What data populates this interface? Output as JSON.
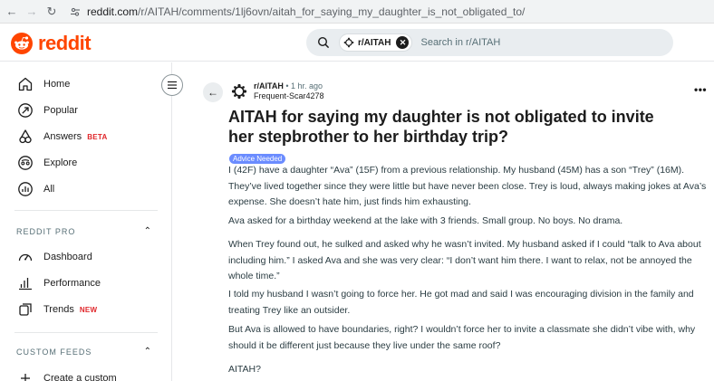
{
  "browser": {
    "url_host": "reddit.com",
    "url_path": "/r/AITAH/comments/1lj6ovn/aitah_for_saying_my_daughter_is_not_obligated_to/",
    "back_icon": "arrow-left-icon",
    "forward_icon": "arrow-right-icon",
    "reload_icon": "reload-icon"
  },
  "header": {
    "logo_text": "reddit",
    "brand_color": "#ff4500",
    "search": {
      "chip_label": "r/AITAH",
      "placeholder": "Search in r/AITAH"
    }
  },
  "sidebar": {
    "items": [
      {
        "label": "Home",
        "icon": "home-icon"
      },
      {
        "label": "Popular",
        "icon": "popular-icon"
      },
      {
        "label": "Answers",
        "badge": "BETA",
        "icon": "answers-icon"
      },
      {
        "label": "Explore",
        "icon": "explore-icon"
      },
      {
        "label": "All",
        "icon": "all-icon"
      }
    ],
    "pro_heading": "REDDIT PRO",
    "pro_items": [
      {
        "label": "Dashboard",
        "icon": "dashboard-icon"
      },
      {
        "label": "Performance",
        "icon": "performance-icon"
      },
      {
        "label": "Trends",
        "badge": "NEW",
        "icon": "trends-icon"
      }
    ],
    "feeds_heading": "CUSTOM FEEDS",
    "feeds_items": [
      {
        "label": "Create a custom",
        "icon": "plus-icon"
      }
    ]
  },
  "post": {
    "subreddit": "r/AITAH",
    "time": "• 1 hr. ago",
    "author": "Frequent-Scar4278",
    "title": "AITAH for saying my daughter is not obligated to invite her stepbrother to her birthday trip?",
    "flair": "Advice Needed",
    "flair_color": "#6b8cff",
    "paragraphs": [
      "I (42F) have a daughter “Ava” (15F) from a previous relationship. My husband (45M) has a son “Trey” (16M). They’ve lived together since they were little but have never been close. Trey is loud, always making jokes at Ava’s expense. She doesn’t hate him, just finds him exhausting.",
      "Ava asked for a birthday weekend at the lake with 3 friends. Small group. No boys. No drama.",
      "When Trey found out, he sulked and asked why he wasn’t invited. My husband asked if I could “talk to Ava about including him.” I asked Ava and she was very clear: “I don’t want him there. I want to relax, not be annoyed the whole time.”",
      "I told my husband I wasn’t going to force her. He got mad and said I was encouraging division in the family and treating Trey like an outsider.",
      "But Ava is allowed to have boundaries, right? I wouldn’t force her to invite a classmate she didn’t vibe with, why should it be different just because they live under the same roof?",
      "AITAH?"
    ]
  }
}
